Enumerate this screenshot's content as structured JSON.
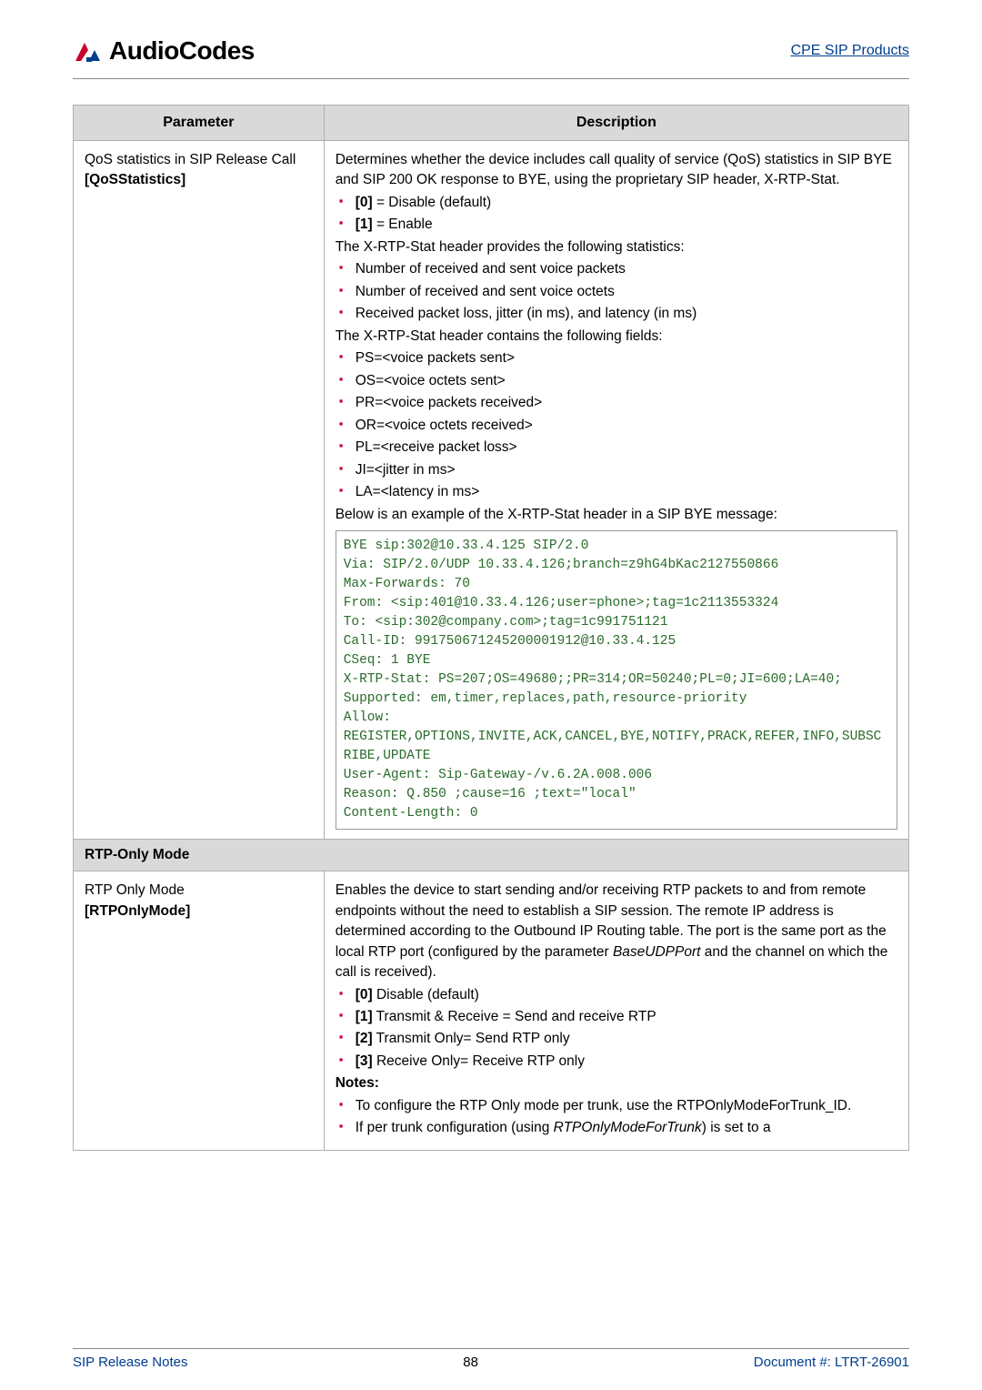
{
  "header": {
    "logo_text": "AudioCodes",
    "right_link": "CPE SIP Products"
  },
  "table": {
    "col_param": "Parameter",
    "col_desc": "Description",
    "row1": {
      "param_line1": "QoS statistics in SIP Release Call",
      "param_line2": "[QoSStatistics]",
      "desc_intro": "Determines whether the device includes call quality of service (QoS) statistics in SIP BYE and SIP 200 OK response to BYE, using the proprietary SIP header, X-RTP-Stat.",
      "opt0": "[0]",
      "opt0_rest": " = Disable (default)",
      "opt1": "[1]",
      "opt1_rest": " = Enable",
      "stat_intro": "The X-RTP-Stat header provides the following statistics:",
      "s1": "Number of received and sent voice packets",
      "s2": "Number of received and sent voice octets",
      "s3": "Received packet loss, jitter (in ms), and latency (in ms)",
      "fields_intro": "The X-RTP-Stat header contains the following fields:",
      "f1": "PS=<voice packets sent>",
      "f2": "OS=<voice octets sent>",
      "f3": "PR=<voice packets received>",
      "f4": "OR=<voice octets received>",
      "f5": "PL=<receive packet loss>",
      "f6": "JI=<jitter in ms>",
      "f7": "LA=<latency in ms>",
      "example_intro": "Below is an example of the X-RTP-Stat header in a SIP BYE message:",
      "code": "BYE sip:302@10.33.4.125 SIP/2.0\nVia: SIP/2.0/UDP 10.33.4.126;branch=z9hG4bKac2127550866\nMax-Forwards: 70\nFrom: <sip:401@10.33.4.126;user=phone>;tag=1c2113553324\nTo: <sip:302@company.com>;tag=1c991751121\nCall-ID: 991750671245200001912@10.33.4.125\nCSeq: 1 BYE\nX-RTP-Stat: PS=207;OS=49680;;PR=314;OR=50240;PL=0;JI=600;LA=40;\nSupported: em,timer,replaces,path,resource-priority\nAllow: REGISTER,OPTIONS,INVITE,ACK,CANCEL,BYE,NOTIFY,PRACK,REFER,INFO,SUBSCRIBE,UPDATE\nUser-Agent: Sip-Gateway-/v.6.2A.008.006\nReason: Q.850 ;cause=16 ;text=\"local\"\nContent-Length: 0"
    },
    "section_rtp": "RTP-Only Mode",
    "row2": {
      "param_line1": "RTP Only Mode",
      "param_line2": "[RTPOnlyMode]",
      "desc_intro_a": "Enables the device to start sending and/or receiving RTP packets to and from remote endpoints without the need to establish a SIP session. The remote IP address is determined according to the Outbound IP Routing table. The port is the same port as the local RTP port (configured by the parameter ",
      "desc_intro_b": "BaseUDPPort",
      "desc_intro_c": " and the channel on which the call is received).",
      "r0": "[0]",
      "r0_rest": " Disable (default)",
      "r1": "[1]",
      "r1_rest": " Transmit & Receive = Send and receive RTP",
      "r2": "[2]",
      "r2_rest": " Transmit Only= Send RTP only",
      "r3": "[3]",
      "r3_rest": " Receive Only= Receive RTP only",
      "notes_label": "Notes:",
      "n1": "To configure the RTP Only mode per trunk, use the RTPOnlyModeForTrunk_ID.",
      "n2_a": "If per trunk configuration (using ",
      "n2_b": "RTPOnlyModeForTrunk",
      "n2_c": ") is set to a"
    }
  },
  "footer": {
    "left": "SIP Release Notes",
    "center": "88",
    "right": "Document #: LTRT-26901"
  }
}
